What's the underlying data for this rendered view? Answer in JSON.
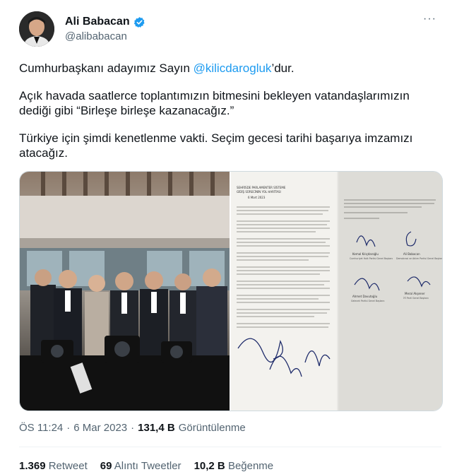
{
  "author": {
    "display_name": "Ali Babacan",
    "handle": "@alibabacan"
  },
  "menu": {
    "more_label": "···"
  },
  "tweet": {
    "p1_before": "Cumhurbaşkanı adayımız Sayın ",
    "p1_mention": "@kilicdarogluk",
    "p1_after": "’dur.",
    "p2": "Açık havada saatlerce toplantımızın bitmesini bekleyen vatandaşlarımızın dediği gibi “Birleşe birleşe kazanacağız.”",
    "p3": "Türkiye için şimdi kenetlenme vakti. Seçim gecesi tarihi başarıya imzamızı atacağız."
  },
  "media": {
    "document": {
      "header_line1": "SEHRİSDE PARLAMENTER SİSTEME",
      "header_line2": "GİDİŞ SÜRECİNİN YOL HARİTASI",
      "date": "6 Mart 2023",
      "sig1_name": "Kemal Kılıçdaroğlu",
      "sig1_party": "Cumhuriyet Halk Partisi Genel Başkanı",
      "sig2_name": "Ali Babacan",
      "sig2_party": "Demokrasi ve Atılım Partisi Genel Başkanı",
      "sig3_name": "Ahmet Davutoğlu",
      "sig3_party": "Gelecek Partisi Genel Başkanı",
      "sig4_name": "Meral Akşener",
      "sig4_party": "İYİ Parti Genel Başkanı"
    }
  },
  "meta": {
    "time": "ÖS 11:24",
    "sep": "·",
    "date": "6 Mar 2023",
    "views_count": "131,4 B",
    "views_label": "Görüntülenme"
  },
  "stats": {
    "retweets_count": "1.369",
    "retweets_label": "Retweet",
    "quotes_count": "69",
    "quotes_label": "Alıntı Tweetler",
    "likes_count": "10,2 B",
    "likes_label": "Beğenme"
  },
  "colors": {
    "accent": "#1d9bf0",
    "muted": "#536471",
    "text": "#0f1419"
  }
}
